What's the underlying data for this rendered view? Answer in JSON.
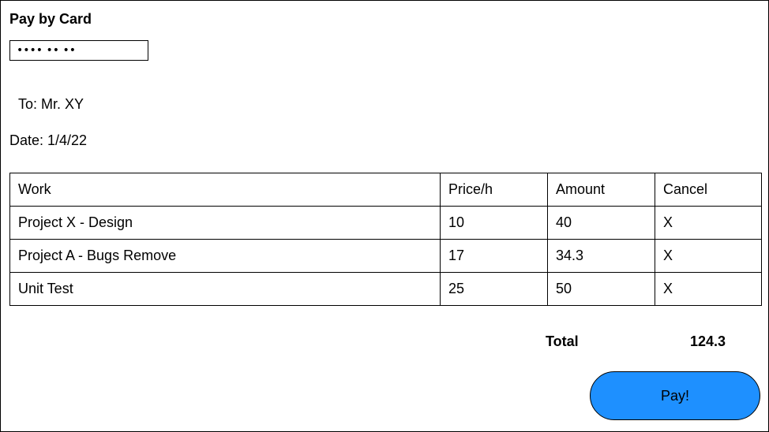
{
  "header": {
    "title": "Pay by Card"
  },
  "card": {
    "masked_value": "•••• •• ••"
  },
  "recipient": {
    "label": "To: Mr. XY"
  },
  "date": {
    "label": "Date: 1/4/22"
  },
  "table": {
    "headers": [
      "Work",
      "Price/h",
      "Amount",
      "Cancel"
    ],
    "rows": [
      {
        "work": "Project X - Design",
        "price": "10",
        "amount": "40",
        "cancel": "X"
      },
      {
        "work": "Project A - Bugs Remove",
        "price": "17",
        "amount": "34.3",
        "cancel": "X"
      },
      {
        "work": "Unit Test",
        "price": "25",
        "amount": "50",
        "cancel": "X"
      }
    ]
  },
  "summary": {
    "total_label": "Total",
    "total_value": "124.3"
  },
  "actions": {
    "pay_label": "Pay!"
  },
  "colors": {
    "pay_button": "#1e90ff",
    "border": "#000000",
    "background": "#ffffff"
  }
}
